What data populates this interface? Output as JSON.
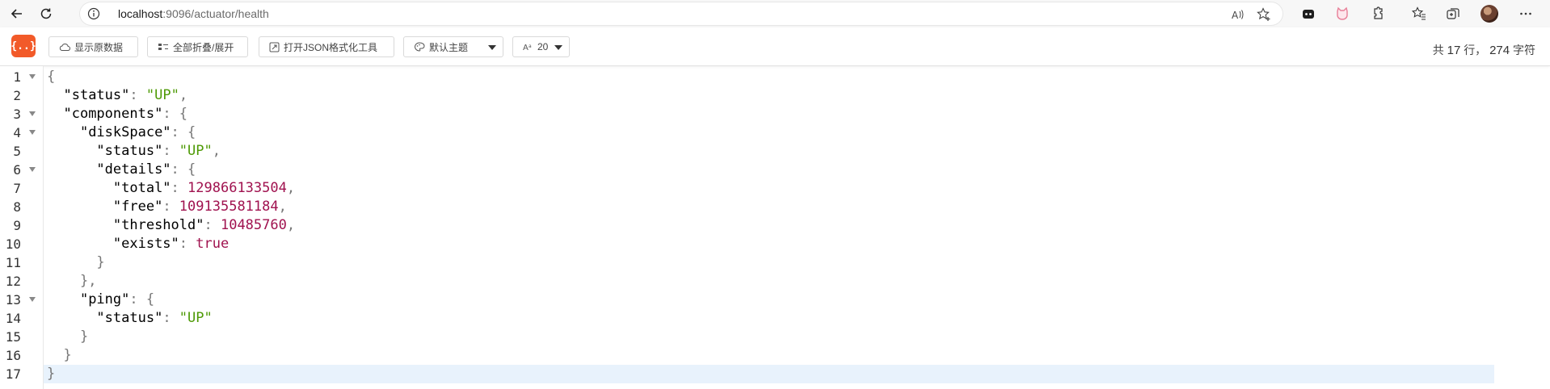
{
  "browser": {
    "url_host": "localhost",
    "url_rest": ":9096/actuator/health"
  },
  "toolbar": {
    "logo": "{..}",
    "buttons": [
      {
        "label": "显示原数据"
      },
      {
        "label": "全部折叠/展开"
      },
      {
        "label": "打开JSON格式化工具"
      }
    ],
    "theme_select": {
      "value": "默认主题"
    },
    "font_size_select": {
      "value": "20"
    },
    "stats": {
      "prefix": "共",
      "lines": "17",
      "lines_unit": "行，",
      "chars": "274",
      "chars_unit": "字符"
    }
  },
  "editor": {
    "lines": [
      {
        "n": "1"
      },
      {
        "n": "2"
      },
      {
        "n": "3"
      },
      {
        "n": "4"
      },
      {
        "n": "5"
      },
      {
        "n": "6"
      },
      {
        "n": "7"
      },
      {
        "n": "8"
      },
      {
        "n": "9"
      },
      {
        "n": "10"
      },
      {
        "n": "11"
      },
      {
        "n": "12"
      },
      {
        "n": "13"
      },
      {
        "n": "14"
      },
      {
        "n": "15"
      },
      {
        "n": "16"
      },
      {
        "n": "17"
      }
    ],
    "json": {
      "k_status": "\"status\"",
      "k_components": "\"components\"",
      "k_diskSpace": "\"diskSpace\"",
      "k_details": "\"details\"",
      "k_total": "\"total\"",
      "k_free": "\"free\"",
      "k_threshold": "\"threshold\"",
      "k_exists": "\"exists\"",
      "k_ping": "\"ping\"",
      "v_up": "\"UP\"",
      "v_total": "129866133504",
      "v_free": "109135581184",
      "v_threshold": "10485760",
      "v_exists": "true"
    }
  },
  "colors": {
    "logo": "#f25a29",
    "string": "#4e9a06",
    "number": "#a0124f",
    "current_line": "#e8f2fc"
  }
}
